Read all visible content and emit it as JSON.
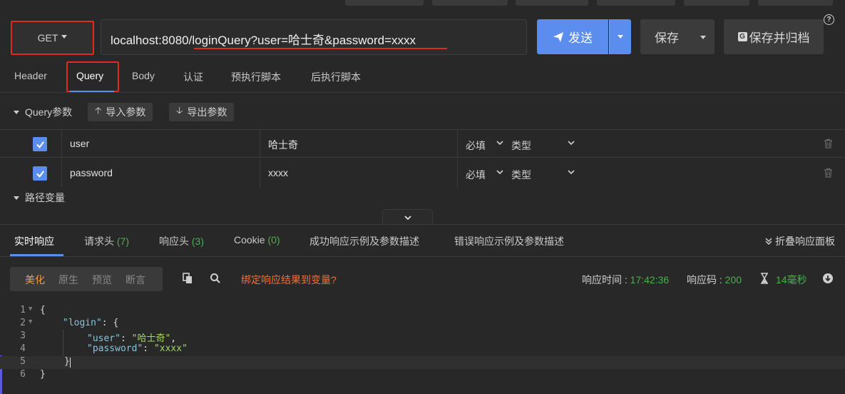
{
  "request": {
    "method": "GET",
    "url": "localhost:8080/loginQuery?user=哈士奇&password=xxxx",
    "send_label": "发送",
    "save_label": "保存",
    "save_archive_label": "保存并归档",
    "help_symbol": "?"
  },
  "request_tabs": [
    "Header",
    "Query",
    "Body",
    "认证",
    "预执行脚本",
    "后执行脚本"
  ],
  "query_section": {
    "title": "Query参数",
    "import_label": "导入参数",
    "export_label": "导出参数"
  },
  "params": [
    {
      "name": "user",
      "value": "哈士奇",
      "required": "必填",
      "type": "类型"
    },
    {
      "name": "password",
      "value": "xxxx",
      "required": "必填",
      "type": "类型"
    }
  ],
  "path_section": {
    "title": "路径变量"
  },
  "response_tabs": {
    "realtime": "实时响应",
    "req_headers": "请求头",
    "req_headers_count": "(7)",
    "resp_headers": "响应头",
    "resp_headers_count": "(3)",
    "cookie": "Cookie",
    "cookie_count": "(0)",
    "success_example": "成功响应示例及参数描述",
    "error_example": "错误响应示例及参数描述",
    "fold_panel": "折叠响应面板"
  },
  "view_modes": [
    "美化",
    "原生",
    "预览",
    "断言"
  ],
  "bind_link": "绑定响应结果到变量?",
  "meta": {
    "time_label": "响应时间 :",
    "time_value": "17:42:36",
    "code_label": "响应码 :",
    "code_value": "200",
    "duration": "14毫秒"
  },
  "code_lines": [
    {
      "n": "1",
      "fold": true
    },
    {
      "n": "2",
      "fold": true
    },
    {
      "n": "3",
      "fold": false
    },
    {
      "n": "4",
      "fold": false
    },
    {
      "n": "5",
      "fold": false
    },
    {
      "n": "6",
      "fold": false
    }
  ],
  "json_body": {
    "open": "{",
    "login_key": "\"login\"",
    "login_open": ": {",
    "user_key": "\"user\"",
    "user_val": "\"哈士奇\"",
    "password_key": "\"password\"",
    "password_val": "\"xxxx\"",
    "inner_close": "}",
    "close": "}"
  },
  "colors": {
    "accent": "#5b8def",
    "highlight_red": "#e0291f",
    "success_green": "#4caf50",
    "link_orange": "#f0703a",
    "active_mode": "#f0a040"
  }
}
